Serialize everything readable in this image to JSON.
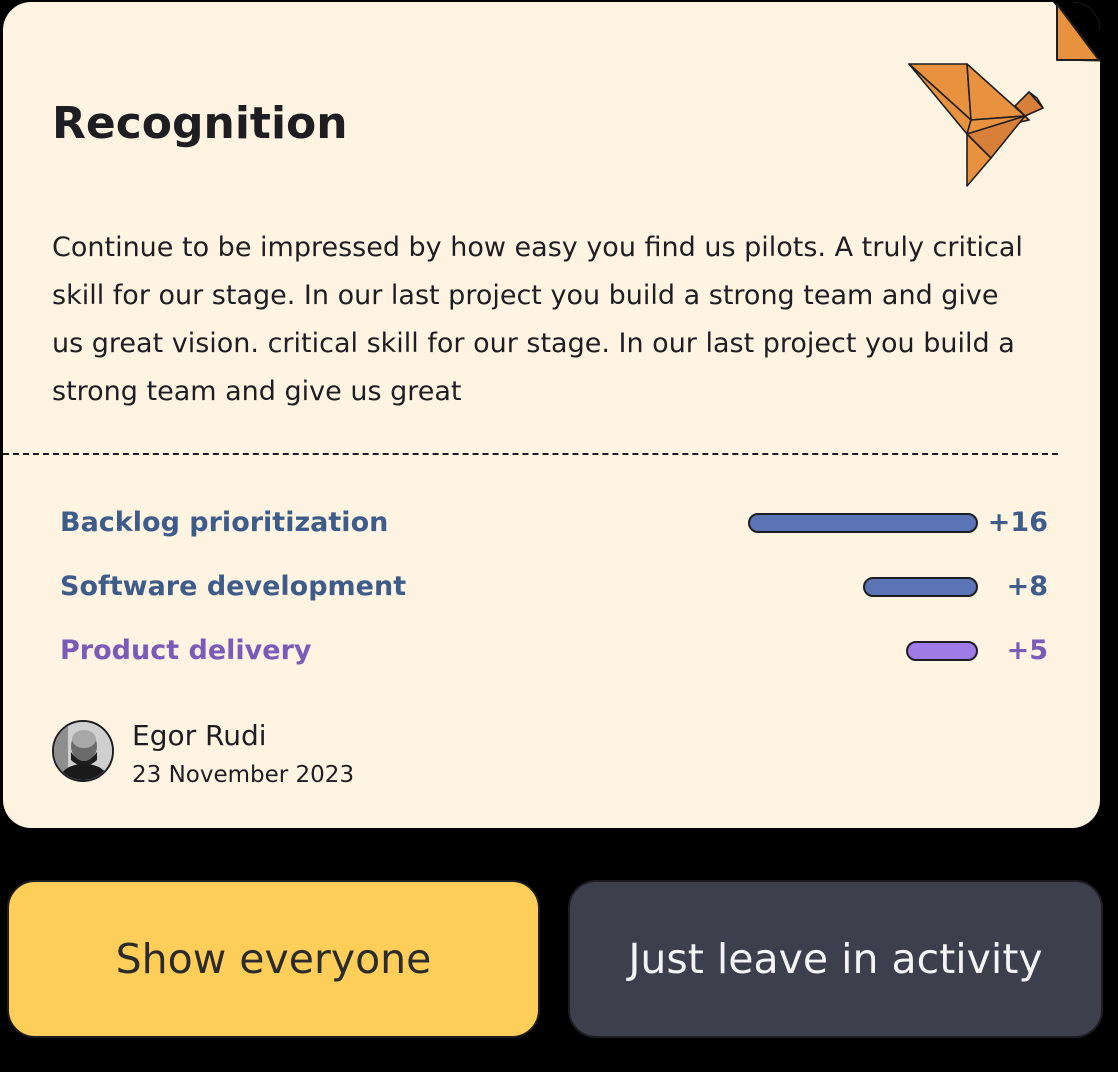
{
  "card": {
    "title": "Recognition",
    "message": "Continue to be impressed by how easy you find us pilots. A truly critical skill for our stage. In our last project you build a strong team and give us great vision. critical skill for our stage. In our last project you build a strong team and give us great",
    "background_color": "#FFF3E2",
    "skills": [
      {
        "name": "Backlog prioritization",
        "score_label": "+16",
        "score": 16,
        "name_color": "#3E5C8A",
        "bar_color": "#5B74B5"
      },
      {
        "name": "Software development",
        "score_label": "+8",
        "score": 8,
        "name_color": "#3E5C8A",
        "bar_color": "#5B74B5"
      },
      {
        "name": "Product delivery",
        "score_label": "+5",
        "score": 5,
        "name_color": "#7B5AB8",
        "bar_color": "#9E7BE6"
      }
    ],
    "author": {
      "name": "Egor Rudi",
      "date": "23 November 2023"
    },
    "decoration_icon": "origami-bird-icon"
  },
  "actions": {
    "show_everyone_label": "Show everyone",
    "just_leave_label": "Just leave in activity",
    "show_everyone_color": "#FFCE59",
    "just_leave_color": "#3D3F4D"
  }
}
